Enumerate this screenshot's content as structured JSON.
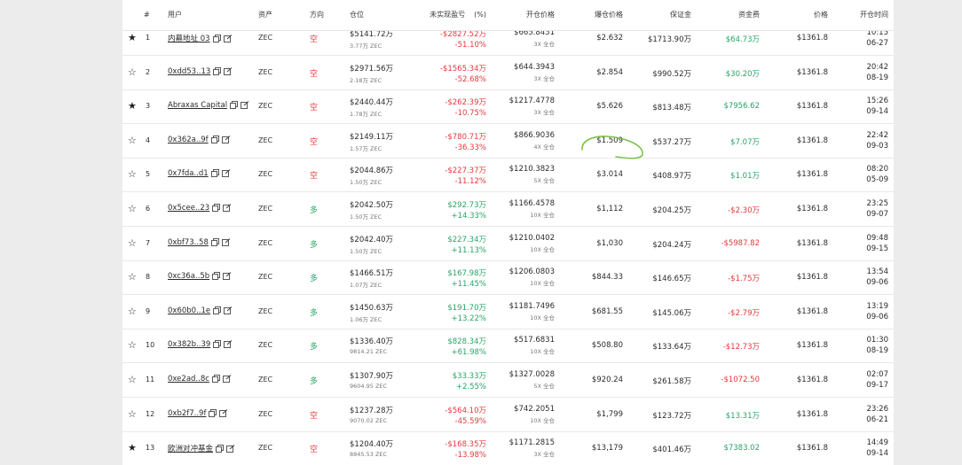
{
  "headers": {
    "index": "#",
    "user": "用户",
    "asset": "资产",
    "direction": "方向",
    "position": "仓位",
    "upnl": "未实现盈亏",
    "upnl_pct": "(%)",
    "entry": "开仓价格",
    "liq": "爆仓价格",
    "margin": "保证金",
    "funding": "资金费",
    "price": "价格",
    "open_time": "开仓时间"
  },
  "colors": {
    "up": "#27a567",
    "down": "#e5383b",
    "annotation": "#7cc24a"
  },
  "rows": [
    {
      "starred": true,
      "idx": "1",
      "user": "内幕地址 03",
      "asset": "ZEC",
      "dir": "空",
      "dir_type": "short",
      "pos_usd": "$5141.72万",
      "pos_coin": "3.77万 ZEC",
      "upnl": "-$2827.52万",
      "upnl_pct": "-51.10%",
      "upnl_type": "dn",
      "entry": "$665.8451",
      "lev": "3X 全仓",
      "liq": "$2.632",
      "margin": "$1713.90万",
      "funding": "$64.73万",
      "funding_type": "up",
      "price": "$1361.8",
      "time": "10:15",
      "date": "06-27"
    },
    {
      "starred": false,
      "idx": "2",
      "user": "0xdd53..13",
      "asset": "ZEC",
      "dir": "空",
      "dir_type": "short",
      "pos_usd": "$2971.56万",
      "pos_coin": "2.18万 ZEC",
      "upnl": "-$1565.34万",
      "upnl_pct": "-52.68%",
      "upnl_type": "dn",
      "entry": "$644.3943",
      "lev": "3X 全仓",
      "liq": "$2.854",
      "margin": "$990.52万",
      "funding": "$30.20万",
      "funding_type": "up",
      "price": "$1361.8",
      "time": "20:42",
      "date": "08-19"
    },
    {
      "starred": true,
      "idx": "3",
      "user": "Abraxas Capital",
      "asset": "ZEC",
      "dir": "空",
      "dir_type": "short",
      "pos_usd": "$2440.44万",
      "pos_coin": "1.78万 ZEC",
      "upnl": "-$262.39万",
      "upnl_pct": "-10.75%",
      "upnl_type": "dn",
      "entry": "$1217.4778",
      "lev": "3X 全仓",
      "liq": "$5.626",
      "margin": "$813.48万",
      "funding": "$7956.62",
      "funding_type": "up",
      "price": "$1361.8",
      "time": "15:26",
      "date": "09-14"
    },
    {
      "starred": false,
      "idx": "4",
      "user": "0x362a..9f",
      "asset": "ZEC",
      "dir": "空",
      "dir_type": "short",
      "pos_usd": "$2149.11万",
      "pos_coin": "1.57万 ZEC",
      "upnl": "-$780.71万",
      "upnl_pct": "-36.33%",
      "upnl_type": "dn",
      "entry": "$866.9036",
      "lev": "4X 全仓",
      "liq": "$1.509",
      "margin": "$537.27万",
      "funding": "$7.07万",
      "funding_type": "up",
      "price": "$1361.8",
      "time": "22:42",
      "date": "09-03"
    },
    {
      "starred": false,
      "idx": "5",
      "user": "0x7fda..d1",
      "asset": "ZEC",
      "dir": "空",
      "dir_type": "short",
      "pos_usd": "$2044.86万",
      "pos_coin": "1.50万 ZEC",
      "upnl": "-$227.37万",
      "upnl_pct": "-11.12%",
      "upnl_type": "dn",
      "entry": "$1210.3823",
      "lev": "5X 全仓",
      "liq": "$3.014",
      "margin": "$408.97万",
      "funding": "$1.01万",
      "funding_type": "up",
      "price": "$1361.8",
      "time": "08:20",
      "date": "05-09"
    },
    {
      "starred": false,
      "idx": "6",
      "user": "0x5cee..23",
      "asset": "ZEC",
      "dir": "多",
      "dir_type": "long",
      "pos_usd": "$2042.50万",
      "pos_coin": "1.50万 ZEC",
      "upnl": "$292.73万",
      "upnl_pct": "+14.33%",
      "upnl_type": "up",
      "entry": "$1166.4578",
      "lev": "10X 全仓",
      "liq": "$1,112",
      "margin": "$204.25万",
      "funding": "-$2.30万",
      "funding_type": "dn",
      "price": "$1361.8",
      "time": "23:25",
      "date": "09-07"
    },
    {
      "starred": false,
      "idx": "7",
      "user": "0xbf73..58",
      "asset": "ZEC",
      "dir": "多",
      "dir_type": "long",
      "pos_usd": "$2042.40万",
      "pos_coin": "1.50万 ZEC",
      "upnl": "$227.34万",
      "upnl_pct": "+11.13%",
      "upnl_type": "up",
      "entry": "$1210.0402",
      "lev": "10X 全仓",
      "liq": "$1,030",
      "margin": "$204.24万",
      "funding": "-$5987.82",
      "funding_type": "dn",
      "price": "$1361.8",
      "time": "09:48",
      "date": "09-15"
    },
    {
      "starred": false,
      "idx": "8",
      "user": "0xc36a..5b",
      "asset": "ZEC",
      "dir": "多",
      "dir_type": "long",
      "pos_usd": "$1466.51万",
      "pos_coin": "1.07万 ZEC",
      "upnl": "$167.98万",
      "upnl_pct": "+11.45%",
      "upnl_type": "up",
      "entry": "$1206.0803",
      "lev": "10X 全仓",
      "liq": "$844.33",
      "margin": "$146.65万",
      "funding": "-$1.75万",
      "funding_type": "dn",
      "price": "$1361.8",
      "time": "13:54",
      "date": "09-06"
    },
    {
      "starred": false,
      "idx": "9",
      "user": "0x60b0..1e",
      "asset": "ZEC",
      "dir": "多",
      "dir_type": "long",
      "pos_usd": "$1450.63万",
      "pos_coin": "1.06万 ZEC",
      "upnl": "$191.70万",
      "upnl_pct": "+13.22%",
      "upnl_type": "up",
      "entry": "$1181.7496",
      "lev": "10X 全仓",
      "liq": "$681.55",
      "margin": "$145.06万",
      "funding": "-$2.79万",
      "funding_type": "dn",
      "price": "$1361.8",
      "time": "13:19",
      "date": "09-06"
    },
    {
      "starred": false,
      "idx": "10",
      "user": "0x382b..39",
      "asset": "ZEC",
      "dir": "多",
      "dir_type": "long",
      "pos_usd": "$1336.40万",
      "pos_coin": "9814.21 ZEC",
      "upnl": "$828.34万",
      "upnl_pct": "+61.98%",
      "upnl_type": "up",
      "entry": "$517.6831",
      "lev": "10X 全仓",
      "liq": "$508.80",
      "margin": "$133.64万",
      "funding": "-$12.73万",
      "funding_type": "dn",
      "price": "$1361.8",
      "time": "01:30",
      "date": "08-19"
    },
    {
      "starred": false,
      "idx": "11",
      "user": "0xe2ad..8c",
      "asset": "ZEC",
      "dir": "多",
      "dir_type": "long",
      "pos_usd": "$1307.90万",
      "pos_coin": "9604.95 ZEC",
      "upnl": "$33.33万",
      "upnl_pct": "+2.55%",
      "upnl_type": "up",
      "entry": "$1327.0028",
      "lev": "5X 全仓",
      "liq": "$920.24",
      "margin": "$261.58万",
      "funding": "-$1072.50",
      "funding_type": "dn",
      "price": "$1361.8",
      "time": "02:07",
      "date": "09-17"
    },
    {
      "starred": false,
      "idx": "12",
      "user": "0xb2f7..9f",
      "asset": "ZEC",
      "dir": "空",
      "dir_type": "short",
      "pos_usd": "$1237.28万",
      "pos_coin": "9070.02 ZEC",
      "upnl": "-$564.10万",
      "upnl_pct": "-45.59%",
      "upnl_type": "dn",
      "entry": "$742.2051",
      "lev": "10X 全仓",
      "liq": "$1,799",
      "margin": "$123.72万",
      "funding": "$13.31万",
      "funding_type": "up",
      "price": "$1361.8",
      "time": "23:26",
      "date": "06-21"
    },
    {
      "starred": true,
      "idx": "13",
      "user": "欧洲对冲基金",
      "asset": "ZEC",
      "dir": "空",
      "dir_type": "short",
      "pos_usd": "$1204.40万",
      "pos_coin": "8845.53 ZEC",
      "upnl": "-$168.35万",
      "upnl_pct": "-13.98%",
      "upnl_type": "dn",
      "entry": "$1171.2815",
      "lev": "3X 全仓",
      "liq": "$13,179",
      "margin": "$401.46万",
      "funding": "$7383.02",
      "funding_type": "up",
      "price": "$1361.8",
      "time": "14:49",
      "date": "09-14"
    }
  ]
}
